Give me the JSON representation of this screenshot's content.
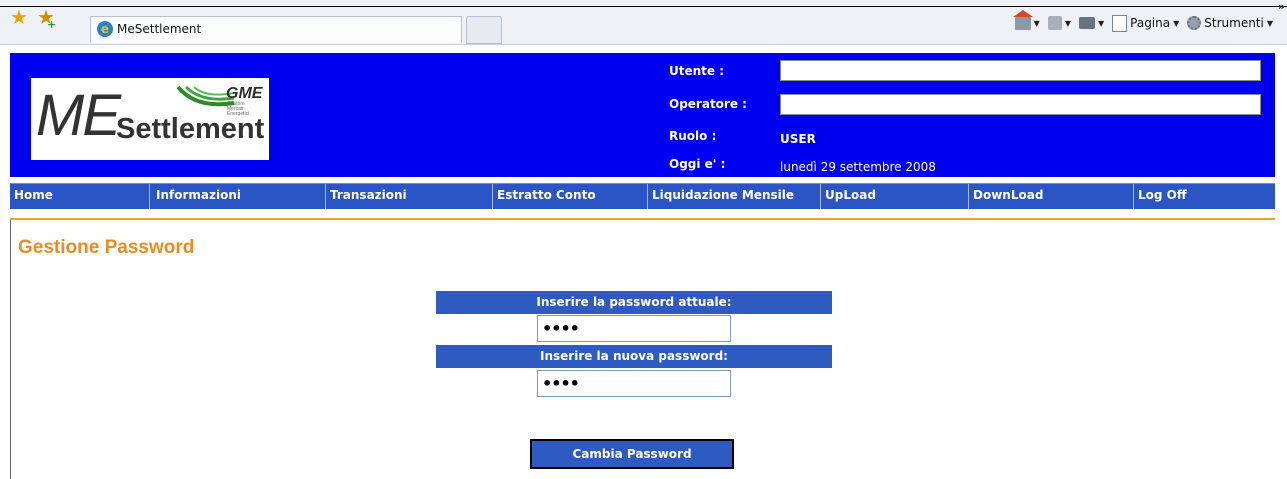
{
  "browser": {
    "tab_title": "MeSettlement",
    "tools": {
      "pagina_label": "Pagina",
      "strumenti_label": "Strumenti"
    }
  },
  "header": {
    "logo": {
      "me": "ME",
      "settlement": "Settlement",
      "gme": "GME",
      "gme_sub": "Gestore Mercati Energetici"
    },
    "utente_label": "Utente :",
    "utente_value": "",
    "operatore_label": "Operatore :",
    "operatore_value": "",
    "ruolo_label": "Ruolo :",
    "ruolo_value": "USER",
    "oggi_label": "Oggi e' :",
    "oggi_value": "lunedì 29 settembre 2008"
  },
  "nav": [
    {
      "label": "Home"
    },
    {
      "label": "Informazioni"
    },
    {
      "label": "Transazioni"
    },
    {
      "label": "Estratto Conto"
    },
    {
      "label": "Liquidazione Mensile"
    },
    {
      "label": "UpLoad"
    },
    {
      "label": "DownLoad"
    },
    {
      "label": "Log Off"
    }
  ],
  "content": {
    "title": "Gestione Password",
    "current_label": "Inserire la password attuale:",
    "current_value": "••••",
    "new_label": "Inserire la nuova password:",
    "new_value": "••••",
    "submit_label": "Cambia Password"
  },
  "colors": {
    "header_bg": "#0000f0",
    "nav_bg": "#2b55c4",
    "title": "#ef8a1e"
  }
}
